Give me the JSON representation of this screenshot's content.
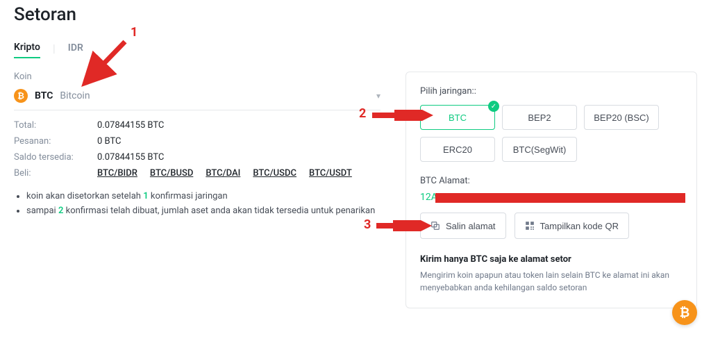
{
  "page_title": "Setoran",
  "tabs": [
    {
      "id": "crypto",
      "label": "Kripto",
      "active": true
    },
    {
      "id": "idr",
      "label": "IDR",
      "active": false
    }
  ],
  "coin": {
    "label": "Koin",
    "symbol": "BTC",
    "name": "Bitcoin",
    "icon": "btc-icon"
  },
  "balances": {
    "total": {
      "label": "Total:",
      "value": "0.07844155 BTC"
    },
    "pesanan": {
      "label": "Pesanan:",
      "value": "0 BTC"
    },
    "saldo": {
      "label": "Saldo tersedia:",
      "value": "0.07844155 BTC"
    }
  },
  "buy": {
    "label": "Beli:",
    "pairs": [
      "BTC/BIDR",
      "BTC/BUSD",
      "BTC/DAI",
      "BTC/USDC",
      "BTC/USDT"
    ]
  },
  "notes": [
    {
      "pre": "koin akan disetorkan setelah ",
      "hl": "1",
      "post": " konfirmasi jaringan"
    },
    {
      "pre": "sampai ",
      "hl": "2",
      "post": " konfirmasi telah dibuat, jumlah aset anda akan tidak tersedia untuk penarikan"
    }
  ],
  "network": {
    "label": "Pilih jaringan::",
    "options": [
      {
        "id": "btc",
        "label": "BTC",
        "selected": true
      },
      {
        "id": "bep2",
        "label": "BEP2",
        "selected": false
      },
      {
        "id": "bep20",
        "label": "BEP20 (BSC)",
        "selected": false
      },
      {
        "id": "erc20",
        "label": "ERC20",
        "selected": false
      },
      {
        "id": "segwit",
        "label": "BTC(SegWit)",
        "selected": false
      }
    ]
  },
  "address": {
    "label": "BTC Alamat:",
    "value_visible": "12A",
    "actions": {
      "copy": "Salin alamat",
      "qr": "Tampilkan kode QR"
    }
  },
  "warning": {
    "title": "Kirim hanya BTC saja ke alamat setor",
    "text": "Mengirim koin apapun atau token lain selain BTC ke alamat ini akan menyebabkan anda kehilangan saldo setoran"
  },
  "annotations": {
    "n1": "1",
    "n2": "2",
    "n3": "3"
  },
  "colors": {
    "accent_green": "#0ecb81",
    "btc_orange": "#f7931a",
    "anno_red": "#e02926"
  }
}
